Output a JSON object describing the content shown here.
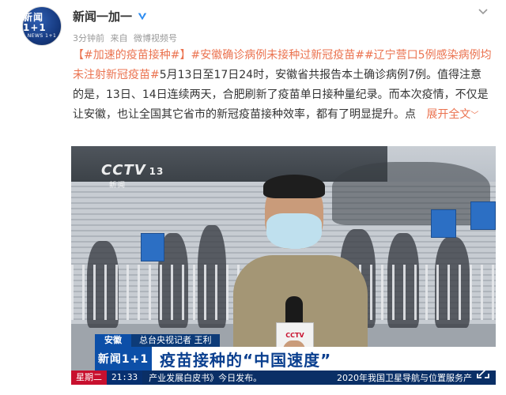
{
  "account": {
    "avatar_line1": "新闻1+1",
    "avatar_line2": "NEWS 1+1",
    "name": "新闻一加一"
  },
  "meta": {
    "time": "3分钟前",
    "source_prefix": "来自",
    "source": "微博视频号"
  },
  "post": {
    "tag1": "【#加速的疫苗接种#】",
    "tag2": "#安徽确诊病例未接种过新冠疫苗#",
    "tag3": "#辽宁营口5例感染病例均未注射新冠疫苗#",
    "body": "5月13日至17日24时，安徽省共报告本土确诊病例7例。值得注意的是，13日、14日连续两天，合肥刷新了疫苗单日接种量纪录。而本次疫情，不仅是让安徽，也让全国其它省市的新冠疫苗接种效率，都有了明显提升。点",
    "expand": "展开全文",
    "expand_arrow": "﹀"
  },
  "video": {
    "channel_logo": "CCTV",
    "channel_number": "13",
    "channel_sub": "新闻",
    "mic_label": "CCTV",
    "location": "安徽",
    "reporter": "总台央视记者 王利",
    "program": "新闻1+1",
    "headline": "疫苗接种的“中国速度”",
    "weekday": "星期二",
    "clock": "21:33",
    "ticker_left": "产业发展白皮书》今日发布。",
    "ticker_right": "2020年我国卫星导航与位置服务产"
  },
  "colors": {
    "link": "#eb7350",
    "cctv_blue": "#0c4fa8",
    "headline_blue": "#0a3f8f",
    "weekday_red": "#c8102e"
  },
  "icons": [
    "verified-badge-icon",
    "chevron-down-icon",
    "fullscreen-icon"
  ]
}
